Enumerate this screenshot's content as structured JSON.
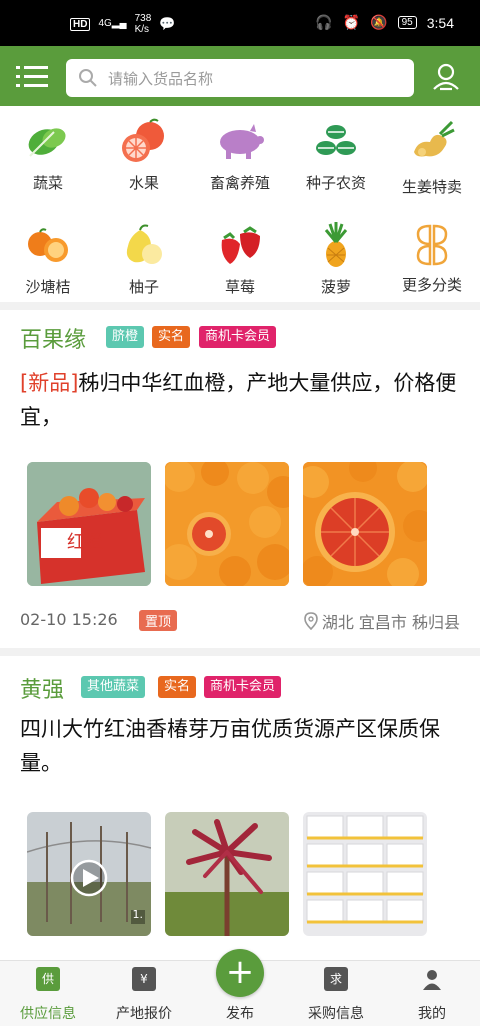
{
  "status_bar": {
    "hd": "HD",
    "net": "4G",
    "speed_value": "738",
    "speed_unit": "K/s",
    "battery": "95",
    "time": "3:54"
  },
  "search": {
    "placeholder": "请输入货品名称"
  },
  "categories": [
    {
      "label": "蔬菜",
      "icon": "vegetable-icon"
    },
    {
      "label": "水果",
      "icon": "fruit-icon"
    },
    {
      "label": "畜禽养殖",
      "icon": "pig-icon"
    },
    {
      "label": "种子农资",
      "icon": "seed-icon"
    },
    {
      "label": "生姜特卖",
      "icon": "ginger-icon"
    },
    {
      "label": "沙塘桔",
      "icon": "tangerine-icon"
    },
    {
      "label": "柚子",
      "icon": "pomelo-icon"
    },
    {
      "label": "草莓",
      "icon": "strawberry-icon"
    },
    {
      "label": "菠萝",
      "icon": "pineapple-icon"
    },
    {
      "label": "更多分类",
      "icon": "more-categories-icon"
    }
  ],
  "posts": [
    {
      "name": "百果缘",
      "tags": [
        "脐橙",
        "实名",
        "商机卡会员"
      ],
      "title_prefix": "[新品]",
      "title": "秭归中华红血橙，产地大量供应，价格便宜，",
      "time": "02-10 15:26",
      "pin": "置顶",
      "location": "湖北 宜昌市 秭归县"
    },
    {
      "name": "黄强",
      "tags": [
        "其他蔬菜",
        "实名",
        "商机卡会员"
      ],
      "title_prefix": "",
      "title": "四川大竹红油香椿芽万亩优质货源产区保质保量。",
      "video_count": "1."
    }
  ],
  "tabs": [
    {
      "label": "供应信息",
      "icon_text": "供"
    },
    {
      "label": "产地报价",
      "icon_text": "¥"
    },
    {
      "label": "发布",
      "icon_text": "+"
    },
    {
      "label": "采购信息",
      "icon_text": "求"
    },
    {
      "label": "我的",
      "icon_text": ""
    }
  ],
  "colors": {
    "brand_green": "#5a9c3c",
    "tag_teal": "#5cc8b0",
    "tag_orange": "#e8681e",
    "tag_pink": "#e0236a",
    "new_red": "#e0412b"
  }
}
